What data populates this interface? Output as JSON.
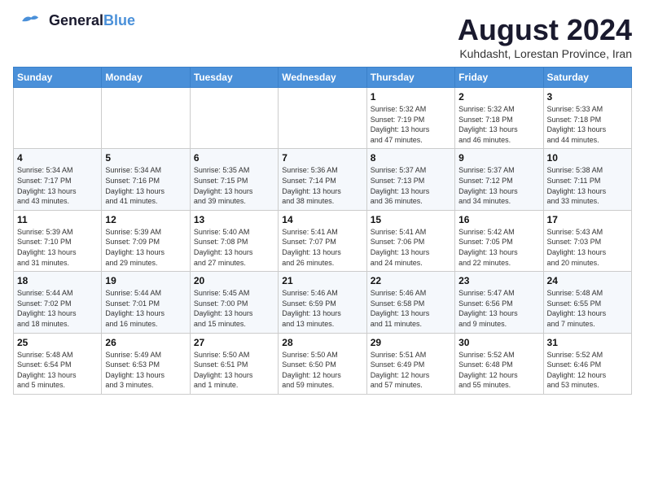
{
  "header": {
    "logo_general": "General",
    "logo_blue": "Blue",
    "month": "August 2024",
    "location": "Kuhdasht, Lorestan Province, Iran"
  },
  "weekdays": [
    "Sunday",
    "Monday",
    "Tuesday",
    "Wednesday",
    "Thursday",
    "Friday",
    "Saturday"
  ],
  "weeks": [
    [
      {
        "day": "",
        "info": ""
      },
      {
        "day": "",
        "info": ""
      },
      {
        "day": "",
        "info": ""
      },
      {
        "day": "",
        "info": ""
      },
      {
        "day": "1",
        "info": "Sunrise: 5:32 AM\nSunset: 7:19 PM\nDaylight: 13 hours\nand 47 minutes."
      },
      {
        "day": "2",
        "info": "Sunrise: 5:32 AM\nSunset: 7:18 PM\nDaylight: 13 hours\nand 46 minutes."
      },
      {
        "day": "3",
        "info": "Sunrise: 5:33 AM\nSunset: 7:18 PM\nDaylight: 13 hours\nand 44 minutes."
      }
    ],
    [
      {
        "day": "4",
        "info": "Sunrise: 5:34 AM\nSunset: 7:17 PM\nDaylight: 13 hours\nand 43 minutes."
      },
      {
        "day": "5",
        "info": "Sunrise: 5:34 AM\nSunset: 7:16 PM\nDaylight: 13 hours\nand 41 minutes."
      },
      {
        "day": "6",
        "info": "Sunrise: 5:35 AM\nSunset: 7:15 PM\nDaylight: 13 hours\nand 39 minutes."
      },
      {
        "day": "7",
        "info": "Sunrise: 5:36 AM\nSunset: 7:14 PM\nDaylight: 13 hours\nand 38 minutes."
      },
      {
        "day": "8",
        "info": "Sunrise: 5:37 AM\nSunset: 7:13 PM\nDaylight: 13 hours\nand 36 minutes."
      },
      {
        "day": "9",
        "info": "Sunrise: 5:37 AM\nSunset: 7:12 PM\nDaylight: 13 hours\nand 34 minutes."
      },
      {
        "day": "10",
        "info": "Sunrise: 5:38 AM\nSunset: 7:11 PM\nDaylight: 13 hours\nand 33 minutes."
      }
    ],
    [
      {
        "day": "11",
        "info": "Sunrise: 5:39 AM\nSunset: 7:10 PM\nDaylight: 13 hours\nand 31 minutes."
      },
      {
        "day": "12",
        "info": "Sunrise: 5:39 AM\nSunset: 7:09 PM\nDaylight: 13 hours\nand 29 minutes."
      },
      {
        "day": "13",
        "info": "Sunrise: 5:40 AM\nSunset: 7:08 PM\nDaylight: 13 hours\nand 27 minutes."
      },
      {
        "day": "14",
        "info": "Sunrise: 5:41 AM\nSunset: 7:07 PM\nDaylight: 13 hours\nand 26 minutes."
      },
      {
        "day": "15",
        "info": "Sunrise: 5:41 AM\nSunset: 7:06 PM\nDaylight: 13 hours\nand 24 minutes."
      },
      {
        "day": "16",
        "info": "Sunrise: 5:42 AM\nSunset: 7:05 PM\nDaylight: 13 hours\nand 22 minutes."
      },
      {
        "day": "17",
        "info": "Sunrise: 5:43 AM\nSunset: 7:03 PM\nDaylight: 13 hours\nand 20 minutes."
      }
    ],
    [
      {
        "day": "18",
        "info": "Sunrise: 5:44 AM\nSunset: 7:02 PM\nDaylight: 13 hours\nand 18 minutes."
      },
      {
        "day": "19",
        "info": "Sunrise: 5:44 AM\nSunset: 7:01 PM\nDaylight: 13 hours\nand 16 minutes."
      },
      {
        "day": "20",
        "info": "Sunrise: 5:45 AM\nSunset: 7:00 PM\nDaylight: 13 hours\nand 15 minutes."
      },
      {
        "day": "21",
        "info": "Sunrise: 5:46 AM\nSunset: 6:59 PM\nDaylight: 13 hours\nand 13 minutes."
      },
      {
        "day": "22",
        "info": "Sunrise: 5:46 AM\nSunset: 6:58 PM\nDaylight: 13 hours\nand 11 minutes."
      },
      {
        "day": "23",
        "info": "Sunrise: 5:47 AM\nSunset: 6:56 PM\nDaylight: 13 hours\nand 9 minutes."
      },
      {
        "day": "24",
        "info": "Sunrise: 5:48 AM\nSunset: 6:55 PM\nDaylight: 13 hours\nand 7 minutes."
      }
    ],
    [
      {
        "day": "25",
        "info": "Sunrise: 5:48 AM\nSunset: 6:54 PM\nDaylight: 13 hours\nand 5 minutes."
      },
      {
        "day": "26",
        "info": "Sunrise: 5:49 AM\nSunset: 6:53 PM\nDaylight: 13 hours\nand 3 minutes."
      },
      {
        "day": "27",
        "info": "Sunrise: 5:50 AM\nSunset: 6:51 PM\nDaylight: 13 hours\nand 1 minute."
      },
      {
        "day": "28",
        "info": "Sunrise: 5:50 AM\nSunset: 6:50 PM\nDaylight: 12 hours\nand 59 minutes."
      },
      {
        "day": "29",
        "info": "Sunrise: 5:51 AM\nSunset: 6:49 PM\nDaylight: 12 hours\nand 57 minutes."
      },
      {
        "day": "30",
        "info": "Sunrise: 5:52 AM\nSunset: 6:48 PM\nDaylight: 12 hours\nand 55 minutes."
      },
      {
        "day": "31",
        "info": "Sunrise: 5:52 AM\nSunset: 6:46 PM\nDaylight: 12 hours\nand 53 minutes."
      }
    ]
  ]
}
